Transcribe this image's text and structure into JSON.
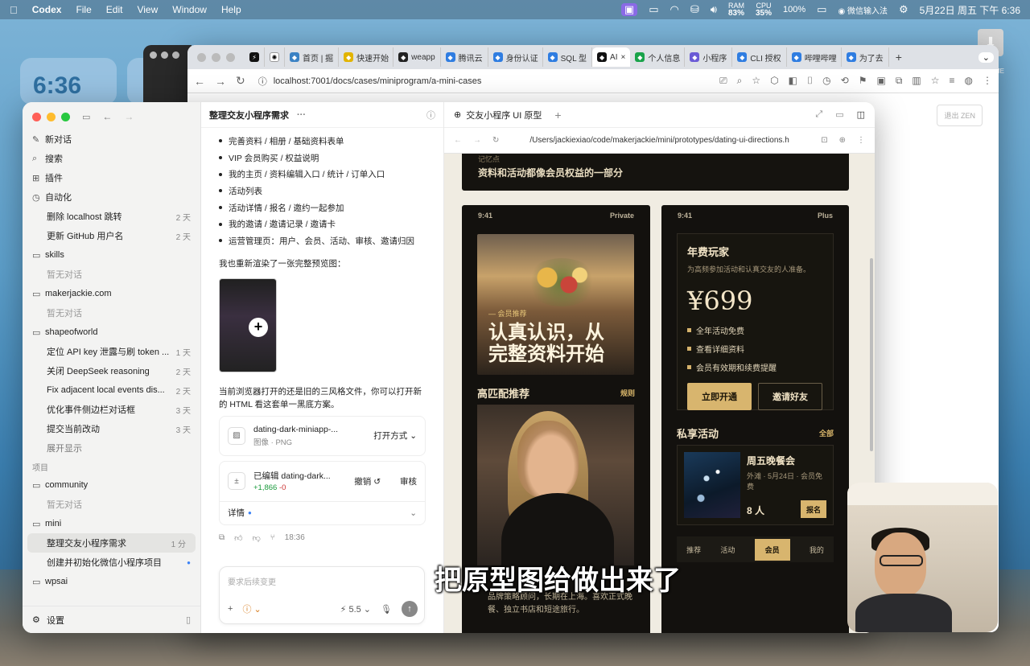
{
  "menubar": {
    "app": "Codex",
    "menus": [
      "File",
      "Edit",
      "View",
      "Window",
      "Help"
    ],
    "ram_label": "RAM",
    "ram": "83%",
    "cpu_label": "CPU",
    "cpu": "35%",
    "battery": "100%",
    "input_method": "微信输入法",
    "datetime": "5月22日 周五 下午 6:36"
  },
  "desktop": {
    "widget_time": "6:36",
    "download_label": "ME"
  },
  "browser": {
    "tabs": [
      {
        "label": "首页 | 掘",
        "color": "#3b82c4"
      },
      {
        "label": "快速开始",
        "color": "#e2b400"
      },
      {
        "label": "weapp",
        "color": "#222222"
      },
      {
        "label": "腾讯云",
        "color": "#2f7de1"
      },
      {
        "label": "身份认证",
        "color": "#2f7de1"
      },
      {
        "label": "SQL 型",
        "color": "#2f7de1"
      },
      {
        "label": "AI",
        "color": "#111111",
        "active": true
      },
      {
        "label": "个人信息",
        "color": "#19a34a"
      },
      {
        "label": "小程序",
        "color": "#6b5bd6"
      },
      {
        "label": "CLI 授权",
        "color": "#2f7de1"
      },
      {
        "label": "哔哩哔哩",
        "color": "#2f7de1"
      },
      {
        "label": "为了去",
        "color": "#2f7de1"
      }
    ],
    "url": "localhost:7001/docs/cases/miniprogram/a-mini-cases",
    "zen_label": "退出 ZEN"
  },
  "sidebar": {
    "top_items": [
      {
        "icon": "edit-icon",
        "glyph": "✎",
        "label": "新对话"
      },
      {
        "icon": "search-icon",
        "glyph": "⌕",
        "label": "搜索"
      },
      {
        "icon": "plugin-icon",
        "glyph": "⊞",
        "label": "插件"
      },
      {
        "icon": "clock-icon",
        "glyph": "◷",
        "label": "自动化"
      }
    ],
    "automation": [
      {
        "title": "删除 localhost 跳转",
        "meta": "2 天"
      },
      {
        "title": "更新 GitHub 用户名",
        "meta": "2 天"
      }
    ],
    "folders": [
      {
        "name": "skills",
        "empty": "暂无对话",
        "items": []
      },
      {
        "name": "makerjackie.com",
        "empty": "暂无对话",
        "items": []
      },
      {
        "name": "shapeofworld",
        "items": [
          {
            "title": "定位 API key 泄露与刷 token ...",
            "meta": "1 天"
          },
          {
            "title": "关闭 DeepSeek reasoning",
            "meta": "2 天"
          },
          {
            "title": "Fix adjacent local events dis...",
            "meta": "2 天"
          },
          {
            "title": "优化事件侧边栏对话框",
            "meta": "3 天"
          },
          {
            "title": "提交当前改动",
            "meta": "3 天"
          }
        ],
        "more": "展开显示"
      }
    ],
    "projects_label": "项目",
    "projects": [
      {
        "name": "community",
        "empty": "暂无对话"
      },
      {
        "name": "mini",
        "items": [
          {
            "title": "整理交友小程序需求",
            "meta": "1 分",
            "selected": true
          },
          {
            "title": "创建并初始化微信小程序项目",
            "meta": "●"
          }
        ]
      },
      {
        "name": "wpsai"
      }
    ],
    "settings": "设置"
  },
  "chat": {
    "title": "整理交友小程序需求",
    "bullets": [
      "完善资料 / 相册 / 基础资料表单",
      "VIP 会员购买 / 权益说明",
      "我的主页 / 资料编辑入口 / 统计 / 订单入口",
      "活动列表",
      "活动详情 / 报名 / 邀约一起参加",
      "我的邀请 / 邀请记录 / 邀请卡",
      "运营管理页：用户、会员、活动、审核、邀请归因"
    ],
    "para1": "我也重新渲染了一张完整预览图：",
    "para2": "当前浏览器打开的还是旧的三风格文件，你可以打开新的 HTML 看这套单一黑底方案。",
    "file": {
      "name": "dating-dark-miniapp-...",
      "type": "图像 · PNG",
      "action": "打开方式"
    },
    "edit": {
      "name": "已编辑 dating-dark...",
      "added": "+1,866",
      "removed": "-0",
      "undo": "撤销",
      "review": "审核",
      "details": "详情"
    },
    "time": "18:36",
    "composer_placeholder": "要求后续变更",
    "model": "5.5"
  },
  "preview": {
    "title": "交友小程序 UI 原型",
    "path": "/Users/jackiexiao/code/makerjackie/mini/prototypes/dating-ui-directions.h",
    "banner_small": "记忆点",
    "banner": "资料和活动都像会员权益的一部分",
    "phone1": {
      "time": "9:41",
      "label": "Private",
      "hero_tag": "— 会员推荐",
      "hero_title_1": "认真认识，从",
      "hero_title_2": "完整资料开始",
      "section": "高匹配推荐",
      "section_link": "规则",
      "bio": "品牌策略顾问，长期在上海。喜欢正式晚餐、独立书店和短途旅行。"
    },
    "phone2": {
      "time": "9:41",
      "label": "Plus",
      "plan_title": "年费玩家",
      "plan_desc": "为高频参加活动和认真交友的人准备。",
      "price": "¥699",
      "benefits": [
        "全年活动免费",
        "查看详细资料",
        "会员有效期和续费提醒"
      ],
      "primary": "立即开通",
      "secondary": "邀请好友",
      "section": "私享活动",
      "section_link": "全部",
      "event_title": "周五晚餐会",
      "event_desc": "外滩 · 5月24日 · 会员免费",
      "event_count": "8 人",
      "event_btn": "报名",
      "tabs": [
        "推荐",
        "活动",
        "会员",
        "我的"
      ],
      "active_tab": 2
    }
  },
  "caption": "把原型图给做出来了"
}
